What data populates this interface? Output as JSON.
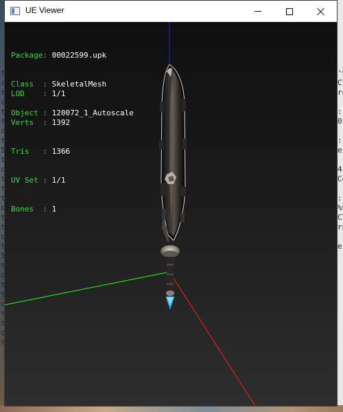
{
  "window": {
    "title": "UE Viewer"
  },
  "mesh_info": {
    "package_label": "Package:",
    "package_value": "00022599.upk",
    "class_label": "Class  :",
    "class_value": "SkeletalMesh",
    "object_label": "Object :",
    "object_value": "120072_1_Autoscale",
    "lod_label": "LOD    :",
    "lod_value": "1/1",
    "verts_label": "Verts  :",
    "verts_value": "1392",
    "tris_label": "Tris   :",
    "tris_value": "1366",
    "uvset_label": "UV Set :",
    "uvset_value": "1/1",
    "bones_label": "Bones  :",
    "bones_value": "1"
  },
  "colors": {
    "axis_x": "#ff1e1e",
    "axis_y": "#22ff22",
    "axis_z": "#1e1eff",
    "label_green": "#3fdc3f"
  },
  "background_text": {
    "left_chars": [
      "t",
      "c",
      "t",
      "c",
      "t",
      "t",
      "c",
      "t",
      "5",
      "t",
      "c",
      "t",
      "t",
      "t",
      "c",
      "t",
      "t",
      "c",
      "t",
      "5",
      "t",
      "c",
      "t",
      "t",
      "c",
      "t",
      "t",
      "c",
      "t"
    ],
    "right_chars": [
      "'9",
      "C\\",
      "ro",
      "",
      ":",
      "0",
      "",
      ":",
      "e",
      "",
      "4",
      "Co",
      "",
      ":",
      "%9",
      "C\\",
      "ro",
      "",
      "e"
    ]
  }
}
